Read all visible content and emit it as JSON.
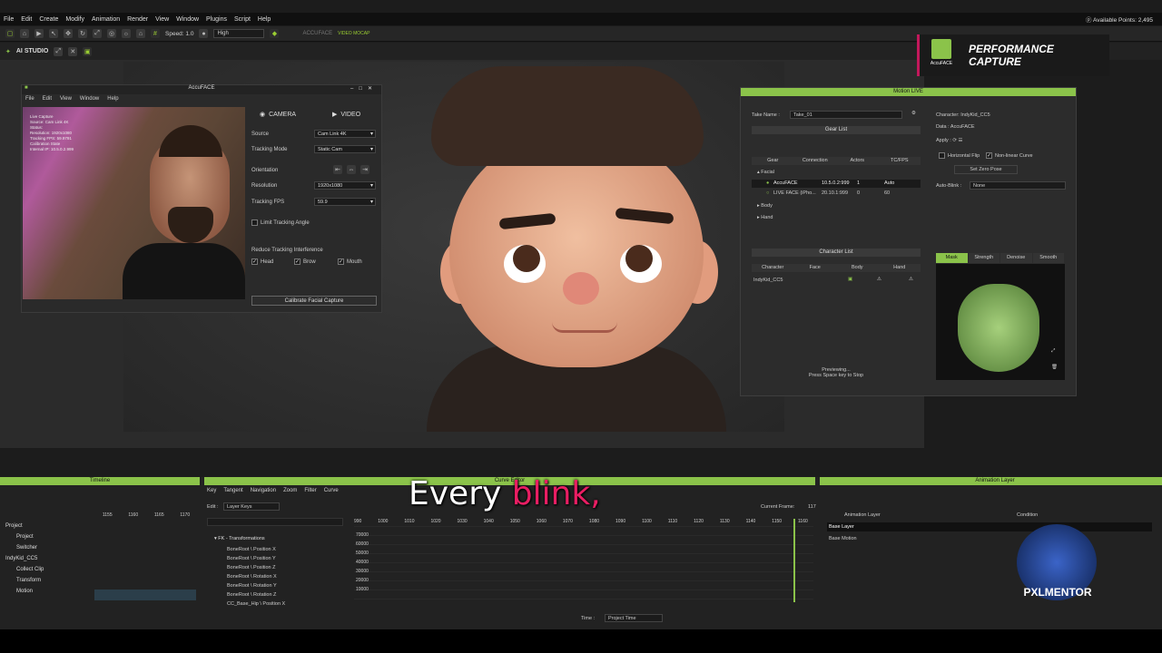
{
  "menu": [
    "File",
    "Edit",
    "Create",
    "Modify",
    "Animation",
    "Render",
    "View",
    "Window",
    "Plugins",
    "Script",
    "Help"
  ],
  "available_points": "Available Points: 2,495",
  "toolbar": {
    "speed": "Speed: 1.0",
    "quality": "High",
    "accuface": "ACCUFACE",
    "video_mocap": "VIDEO MOCAP"
  },
  "ai_studio": "AI STUDIO",
  "accuface_window": {
    "title": "AccuFACE",
    "menu": [
      "File",
      "Edit",
      "View",
      "Window",
      "Help"
    ],
    "cam_info": [
      "Live Capture",
      "Source: Cam Link 4K",
      "Status:",
      "Resolution: 1920x1080",
      "Tracking FPS: 59.9791",
      "Calibration State",
      "Internal IP: 10.5.0.2.999"
    ],
    "tab_camera": "CAMERA",
    "tab_video": "VIDEO",
    "source_label": "Source",
    "source_value": "Cam Link 4K",
    "mode_label": "Tracking Mode",
    "mode_value": "Static Cam",
    "orientation_label": "Orientation",
    "res_label": "Resolution",
    "res_value": "1920x1080",
    "fps_label": "Tracking FPS",
    "fps_value": "59.9",
    "limit_angle": "Limit Tracking Angle",
    "reduce_label": "Reduce Tracking Interference",
    "head": "Head",
    "brow": "Brow",
    "mouth": "Mouth",
    "calibrate": "Calibrate Facial Capture"
  },
  "perf_badge": {
    "logo": "AccuFACE",
    "title": "PERFORMANCE CAPTURE"
  },
  "motion_live": {
    "title": "Motion LIVE",
    "take_label": "Take Name :",
    "take_value": "Take_01",
    "gear_list": "Gear List",
    "gear_cols": [
      "Gear",
      "Connection",
      "Actors",
      "TC/FPS"
    ],
    "facial": "Facial",
    "gears": [
      {
        "name": "AccuFACE",
        "conn": "10.5.0.2:999",
        "actors": "1",
        "fps": "Auto"
      },
      {
        "name": "LIVE FACE (iPho...",
        "conn": "20.10.1:999",
        "actors": "0",
        "fps": "60"
      }
    ],
    "body": "Body",
    "hand": "Hand",
    "char_list": "Character List",
    "char_cols": [
      "Character",
      "Face",
      "Body",
      "Hand"
    ],
    "char_name": "IndyKid_CC5",
    "previewing": "Previewing...",
    "press_space": "Press Space key to Stop",
    "character_label": "Character:",
    "character_value": "IndyKid_CC5",
    "data_label": "Data :",
    "data_value": "AccuFACE",
    "apply_label": "Apply :",
    "hflip": "Horizontal Flip",
    "nonlinear": "Non-linear Curve",
    "zero_pose": "Set Zero Pose",
    "autoblink_label": "Auto-Blink :",
    "autoblink_value": "None",
    "mask_tabs": [
      "Mask",
      "Strength",
      "Denoise",
      "Smooth"
    ]
  },
  "timeline": {
    "title": "Timeline",
    "rows": [
      "Project",
      "Project",
      "Switcher",
      "IndyKid_CC5",
      "Collect Clip",
      "Transform",
      "Motion"
    ],
    "ticks": [
      "1155",
      "1160",
      "1165",
      "1170"
    ]
  },
  "curve_editor": {
    "title": "Curve Editor",
    "menu": [
      "Key",
      "Tangent",
      "Navigation",
      "Zoom",
      "Filter",
      "Curve"
    ],
    "edit_label": "Edit :",
    "edit_value": "Layer Keys",
    "current_frame": "Current Frame:",
    "frame_value": "117",
    "tree_root": "FK - Transformations",
    "tree": [
      "BoneRoot \\ Position X",
      "BoneRoot \\ Position Y",
      "BoneRoot \\ Position Z",
      "BoneRoot \\ Rotation X",
      "BoneRoot \\ Rotation Y",
      "BoneRoot \\ Rotation Z",
      "CC_Base_Hip \\ Position X"
    ],
    "x_ticks": [
      "990",
      "1000",
      "1010",
      "1020",
      "1030",
      "1040",
      "1050",
      "1060",
      "1070",
      "1080",
      "1090",
      "1100",
      "1110",
      "1120",
      "1130",
      "1140",
      "1150",
      "1160"
    ],
    "y_ticks": [
      "70000",
      "60000",
      "50000",
      "40000",
      "30000",
      "20000",
      "10000"
    ],
    "time_label": "Time :",
    "time_value": "Project Time"
  },
  "anim_layer": {
    "title": "Animation Layer",
    "col1": "Animation Layer",
    "col2": "Condition",
    "layers": [
      "Base Layer",
      "Base Motion"
    ]
  },
  "subtitle": {
    "plain": "Every ",
    "highlight": "blink,"
  },
  "watermark": "PXLMENTOR"
}
